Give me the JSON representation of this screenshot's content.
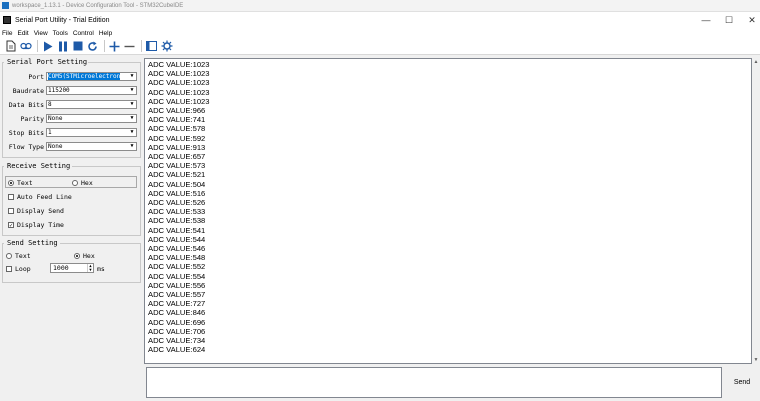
{
  "bg_window": {
    "title": "workspace_1.13.1 - Device Configuration Tool - STM32CubeIDE"
  },
  "window": {
    "title": "Serial Port Utility - Trial Edition",
    "minimize_glyph": "—",
    "maximize_glyph": "☐",
    "close_glyph": "✕"
  },
  "menu": [
    "File",
    "Edit",
    "View",
    "Tools",
    "Control",
    "Help"
  ],
  "toolbar": {
    "icons": [
      "new-file-icon",
      "record-icon",
      "play-icon",
      "pause-icon",
      "stop-icon",
      "refresh-icon",
      "add-icon",
      "remove-icon",
      "window-icon",
      "settings-icon"
    ]
  },
  "serial_port": {
    "title": "Serial Port Setting",
    "port_label": "Port",
    "port_value": "COM5(STMicroelectron",
    "baudrate_label": "Baudrate",
    "baudrate_value": "115200",
    "databits_label": "Data Bits",
    "databits_value": "8",
    "parity_label": "Parity",
    "parity_value": "None",
    "stopbits_label": "Stop Bits",
    "stopbits_value": "1",
    "flowtype_label": "Flow Type",
    "flowtype_value": "None"
  },
  "receive": {
    "title": "Receive Setting",
    "text_label": "Text",
    "hex_label": "Hex",
    "mode": "Text",
    "auto_feed_label": "Auto Feed Line",
    "auto_feed": false,
    "display_send_label": "Display Send",
    "display_send": false,
    "display_time_label": "Display Time",
    "display_time": true
  },
  "send": {
    "title": "Send Setting",
    "text_label": "Text",
    "hex_label": "Hex",
    "mode": "Hex",
    "loop_label": "Loop",
    "loop": false,
    "interval": "1000",
    "unit": "ms",
    "button": "Send",
    "input_value": ""
  },
  "output_lines": [
    "ADC VALUE:1023",
    "ADC VALUE:1023",
    "ADC VALUE:1023",
    "ADC VALUE:1023",
    "ADC VALUE:1023",
    "ADC VALUE:966",
    "ADC VALUE:741",
    "ADC VALUE:578",
    "ADC VALUE:592",
    "ADC VALUE:913",
    "ADC VALUE:657",
    "ADC VALUE:573",
    "ADC VALUE:521",
    "ADC VALUE:504",
    "ADC VALUE:516",
    "ADC VALUE:526",
    "ADC VALUE:533",
    "ADC VALUE:538",
    "ADC VALUE:541",
    "ADC VALUE:544",
    "ADC VALUE:546",
    "ADC VALUE:548",
    "ADC VALUE:552",
    "ADC VALUE:554",
    "ADC VALUE:556",
    "ADC VALUE:557",
    "ADC VALUE:727",
    "ADC VALUE:846",
    "ADC VALUE:696",
    "ADC VALUE:706",
    "ADC VALUE:734",
    "ADC VALUE:624"
  ]
}
